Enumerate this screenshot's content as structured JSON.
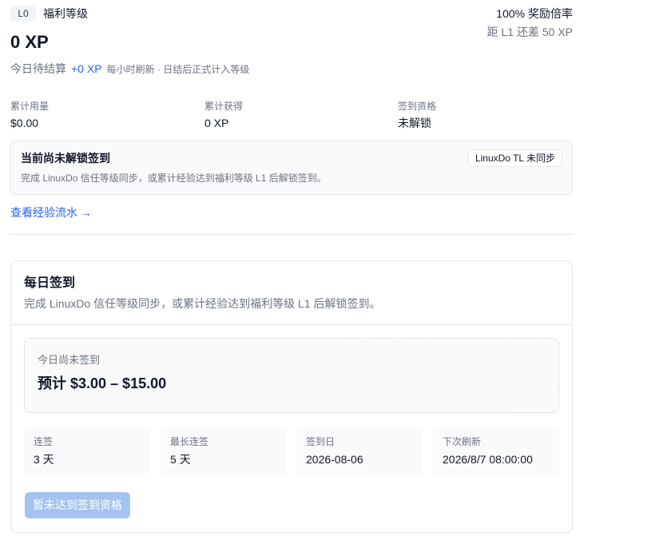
{
  "level": {
    "badge": "L0",
    "name": "福利等级",
    "multiplier": "100% 奖励倍率",
    "xp_total": "0 XP",
    "next_level": "距 L1 还差 50 XP"
  },
  "pending": {
    "label": "今日待结算",
    "xp": "+0 XP",
    "note": "每小时刷新 · 日结后正式计入等级"
  },
  "stats": [
    {
      "label": "累计用量",
      "value": "$0.00"
    },
    {
      "label": "累计获得",
      "value": "0 XP"
    },
    {
      "label": "签到资格",
      "value": "未解锁"
    }
  ],
  "notice": {
    "title": "当前尚未解锁签到",
    "badge": "LinuxDo TL 未同步",
    "desc": "完成 LinuxDo 信任等级同步，或累计经验达到福利等级 L1 后解锁签到。"
  },
  "history_link": "查看经验流水 →",
  "checkin": {
    "title": "每日签到",
    "subtitle": "完成 LinuxDo 信任等级同步，或累计经验达到福利等级 L1 后解锁签到。",
    "today_status": "今日尚未签到",
    "estimate": "预计 $3.00 – $15.00",
    "cards": [
      {
        "label": "连签",
        "value": "3 天"
      },
      {
        "label": "最长连签",
        "value": "5 天"
      },
      {
        "label": "签到日",
        "value": "2026-08-06"
      },
      {
        "label": "下次刷新",
        "value": "2026/8/7 08:00:00"
      }
    ],
    "button": "暂未达到签到资格"
  },
  "colors": {
    "accent": "#2563eb",
    "button_disabled": "#a5c3f0",
    "muted_text": "#6b7280",
    "border": "#e5e7eb"
  }
}
